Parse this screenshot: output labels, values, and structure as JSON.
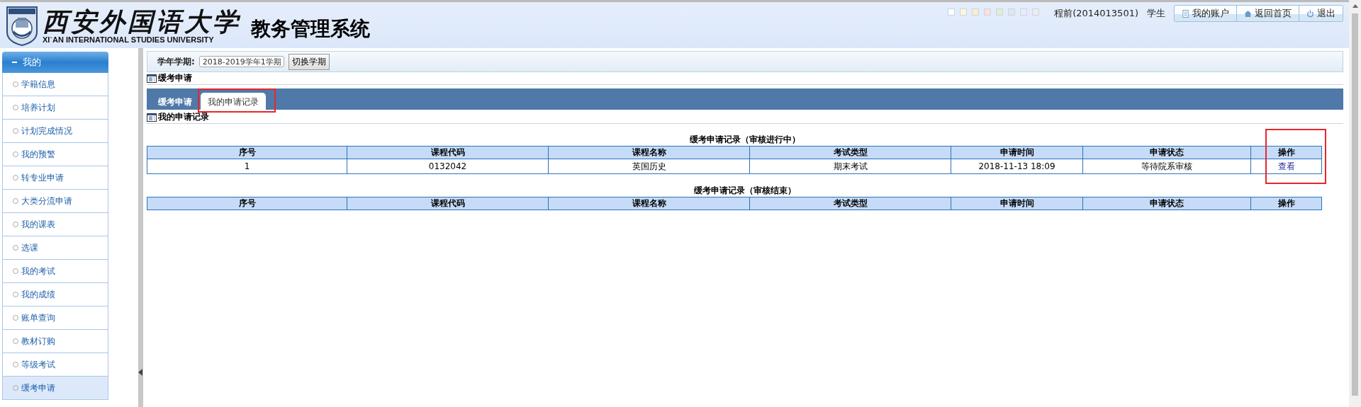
{
  "header": {
    "logo_title": "西安外国语大学",
    "logo_subtitle": "XI`AN INTERNATIONAL STUDIES UNIVERSITY",
    "system_title": "教务管理系统",
    "theme_swatches": [
      {
        "color": "#ffffff"
      },
      {
        "color": "#fbf7d9"
      },
      {
        "color": "#fdeccf"
      },
      {
        "color": "#fbe0dc"
      },
      {
        "color": "#e4ecd4"
      },
      {
        "color": "#e2e4ef"
      },
      {
        "color": "#ecebf8"
      },
      {
        "color": "#ececec"
      }
    ],
    "user": "程前(2014013501)",
    "role": "学生",
    "buttons": [
      {
        "label": "我的账户",
        "kind": "account"
      },
      {
        "label": "返回首页",
        "kind": "home"
      },
      {
        "label": "退出",
        "kind": "logout"
      }
    ]
  },
  "sidebar": {
    "group": "我的",
    "expanded": true,
    "items": [
      {
        "label": "学籍信息",
        "selected": false
      },
      {
        "label": "培养计划",
        "selected": false
      },
      {
        "label": "计划完成情况",
        "selected": false
      },
      {
        "label": "我的预警",
        "selected": false
      },
      {
        "label": "转专业申请",
        "selected": false
      },
      {
        "label": "大类分流申请",
        "selected": false
      },
      {
        "label": "我的课表",
        "selected": false
      },
      {
        "label": "选课",
        "selected": false
      },
      {
        "label": "我的考试",
        "selected": false
      },
      {
        "label": "我的成绩",
        "selected": false
      },
      {
        "label": "账单查询",
        "selected": false
      },
      {
        "label": "教材订购",
        "selected": false
      },
      {
        "label": "等级考试",
        "selected": false
      },
      {
        "label": "缓考申请",
        "selected": true
      }
    ]
  },
  "semester": {
    "label": "学年学期:",
    "value": "2018-2019学年1学期",
    "button": "切换学期"
  },
  "section_title": "缓考申请",
  "tabs": [
    {
      "label": "缓考申请",
      "selected": false,
      "highlighted": false
    },
    {
      "label": "我的申请记录",
      "selected": true,
      "highlighted": true
    }
  ],
  "subsection_title": "我的申请记录",
  "tables": [
    {
      "caption": "缓考申请记录（审核进行中）",
      "columns": [
        "序号",
        "课程代码",
        "课程名称",
        "考试类型",
        "申请时间",
        "申请状态",
        "操作"
      ],
      "action_highlighted": true,
      "rows": [
        {
          "cells": [
            "1",
            "0132042",
            "英国历史",
            "期末考试",
            "2018-11-13 18:09",
            "等待院系审核"
          ],
          "action": "查看"
        }
      ]
    },
    {
      "caption": "缓考申请记录（审核结束）",
      "columns": [
        "序号",
        "课程代码",
        "课程名称",
        "考试类型",
        "申请时间",
        "申请状态",
        "操作"
      ]
    }
  ]
}
